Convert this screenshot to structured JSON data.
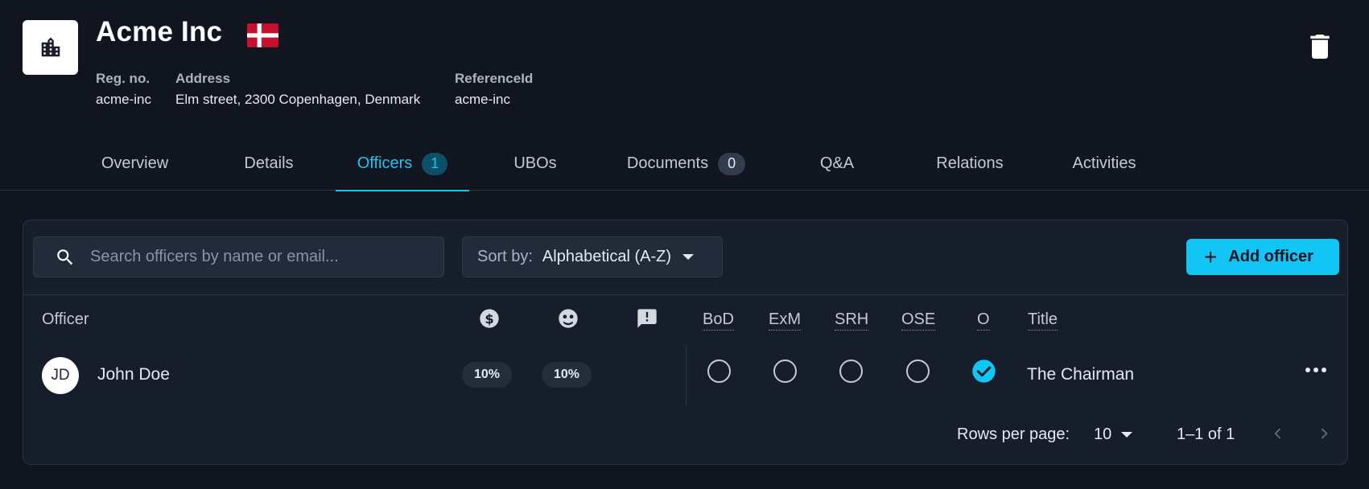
{
  "company": {
    "name": "Acme Inc",
    "fields": [
      {
        "label": "Reg. no.",
        "value": "acme-inc"
      },
      {
        "label": "Address",
        "value": "Elm street, 2300 Copenhagen, Denmark"
      },
      {
        "label": "ReferenceId",
        "value": "acme-inc"
      }
    ],
    "flag_colors": {
      "red": "#c8102e",
      "white": "#ffffff"
    }
  },
  "tabs": [
    {
      "label": "Overview"
    },
    {
      "label": "Details"
    },
    {
      "label": "Officers",
      "count": "1",
      "active": true
    },
    {
      "label": "UBOs"
    },
    {
      "label": "Documents",
      "count": "0"
    },
    {
      "label": "Q&A"
    },
    {
      "label": "Relations"
    },
    {
      "label": "Activities"
    }
  ],
  "toolbar": {
    "search_placeholder": "Search officers by name or email...",
    "sort_label": "Sort by:",
    "sort_value": "Alphabetical (A-Z)",
    "add_label": "Add officer"
  },
  "table": {
    "headers": {
      "officer": "Officer",
      "ownership_icon": "dollar-circle-icon",
      "voting_icon": "face-circle-icon",
      "alerts_icon": "feedback-alert-icon",
      "bod": "BoD",
      "exm": "ExM",
      "srh": "SRH",
      "ose": "OSE",
      "o": "O",
      "title": "Title"
    },
    "rows": [
      {
        "initials": "JD",
        "name": "John Doe",
        "ownership": "10%",
        "voting": "10%",
        "bod": false,
        "exm": false,
        "srh": false,
        "ose": false,
        "o": true,
        "title": "The Chairman"
      }
    ]
  },
  "pagination": {
    "rows_per_page_label": "Rows per page:",
    "rows_per_page": "10",
    "range": "1–1 of 1"
  },
  "colors": {
    "accent": "#11c6f4",
    "background": "#101520",
    "card": "#161d2b"
  }
}
